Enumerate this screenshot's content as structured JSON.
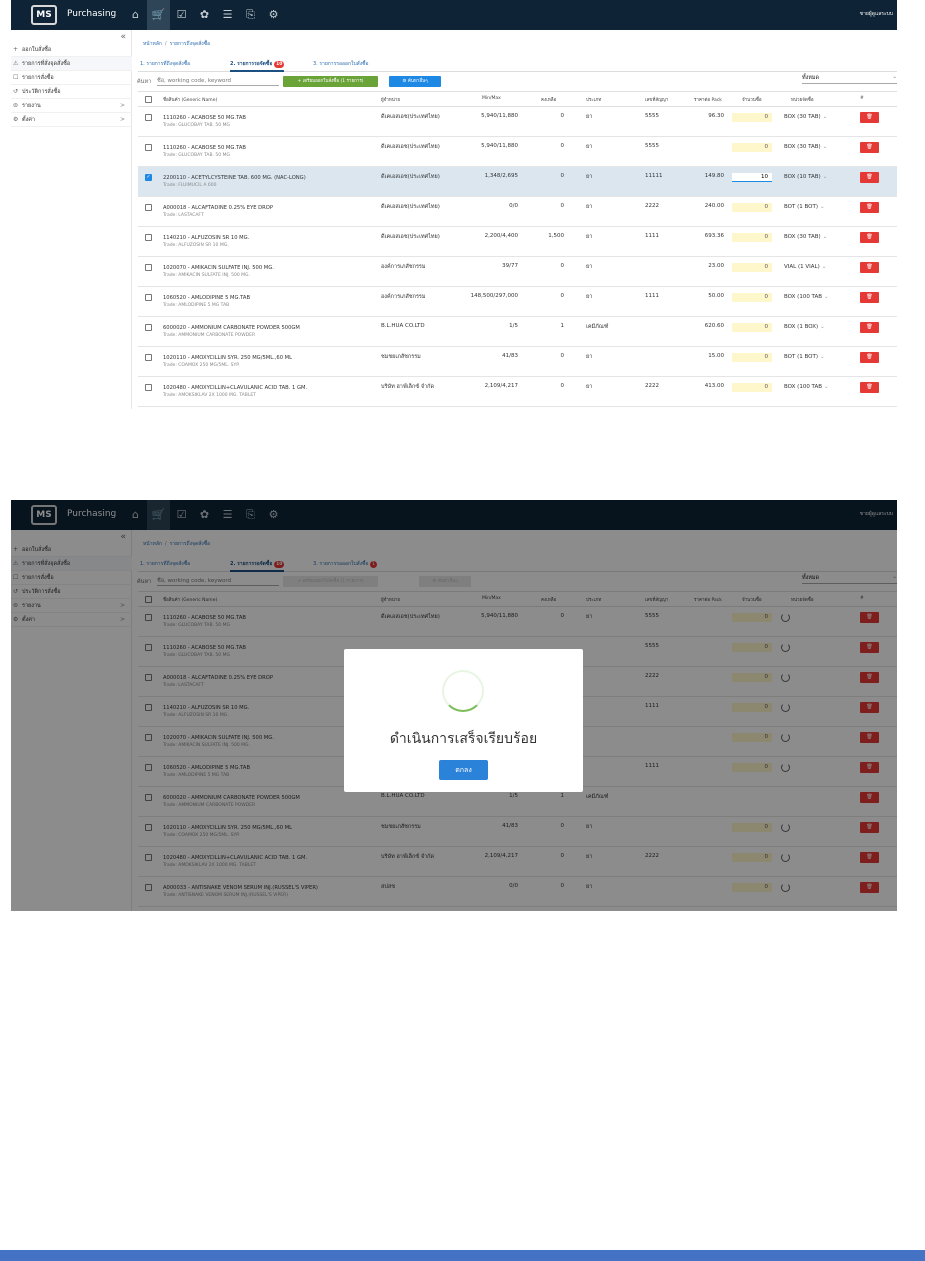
{
  "app": {
    "title": "Purchasing",
    "logo_text": "MS",
    "user": "ชายผู้ดูแลระบบ"
  },
  "nav_icons": [
    "home-icon",
    "cart-icon",
    "check-icon",
    "settings-icon",
    "list-icon",
    "document-icon",
    "gear-icon"
  ],
  "sidebar": {
    "collapse": "«",
    "items": [
      {
        "icon": "+",
        "label": "ออกใบสั่งซื้อ"
      },
      {
        "icon": "⚠",
        "label": "รายการที่สั่งจุดสั่งซื้อ"
      },
      {
        "icon": "☐",
        "label": "รายการสั่งซื้อ"
      },
      {
        "icon": "↺",
        "label": "ประวัติการสั่งซื้อ"
      },
      {
        "icon": "⊜",
        "label": "รายงาน",
        "chevron": ">"
      },
      {
        "icon": "⚙",
        "label": "ตั้งค่า",
        "chevron": ">"
      }
    ]
  },
  "breadcrumb": {
    "home": "หน้าหลัก",
    "sep": "/",
    "current": "รายการถึงจุดสั่งซื้อ"
  },
  "tabs": [
    {
      "label": "1. รายการที่ถึงจุดสั่งซื้อ"
    },
    {
      "label": "2. รายการรอจัดซื้อ",
      "badge": "10"
    },
    {
      "label": "3. รายการรอออกใบสั่งซื้อ",
      "badge": "1"
    }
  ],
  "toolbar": {
    "search_label": "ค้นหา",
    "search_placeholder": "ชื่อ, working code, keyword",
    "add_button": "+ เตรียมออกใบสั่งซื้อ (1 รายการ)",
    "save_button": "⚙ ค้นหาอื่นๆ",
    "filter_value": "ทั้งหมด"
  },
  "table": {
    "headers": [
      "ชื่อสินค้า (Generic Name)",
      "ผู้จำหน่าย",
      "Min/Max",
      "คงเหลือ",
      "ประเภท",
      "เลขที่สัญญา",
      "ราคาต่อ Pack",
      "จำนวนซื้อ",
      "หน่วยจัดซื้อ",
      "#"
    ]
  },
  "shot1": {
    "rows": [
      {
        "name": "1110260 - ACABOSE 50 MG.TAB",
        "trade": "Trade: GLUCOBAY TAB. 50 MG",
        "vendor": "ดีเคเอสเอช(ประเทศไทย)",
        "minmax": "5,940/11,880",
        "stock": "0",
        "type": "ยา",
        "contract": "5555",
        "price": "96.30",
        "qty": "0",
        "unit": "BOX (30 TAB)",
        "checked": false
      },
      {
        "name": "1110260 - ACABOSE 50 MG.TAB",
        "trade": "Trade: GLUCOBAY TAB. 50 MG",
        "vendor": "ดีเคเอสเอช(ประเทศไทย)",
        "minmax": "5,940/11,880",
        "stock": "0",
        "type": "ยา",
        "contract": "5555",
        "price": "",
        "qty": "0",
        "unit": "BOX (30 TAB)",
        "checked": false
      },
      {
        "name": "2200110 - ACETYLCYSTEINE TAB. 600 MG. (NAC-LONG)",
        "trade": "Trade: FLUIMUCIL A 600",
        "vendor": "ดีเคเอสเอช(ประเทศไทย)",
        "minmax": "1,348/2,695",
        "stock": "0",
        "type": "ยา",
        "contract": "11111",
        "price": "149.80",
        "qty": "10",
        "unit": "BOX (10 TAB)",
        "checked": true
      },
      {
        "name": "A000018 - ALCAFTADINE 0.25% EYE DROP",
        "trade": "Trade: LASTACAFT",
        "vendor": "ดีเคเอสเอช(ประเทศไทย)",
        "minmax": "0/0",
        "stock": "0",
        "type": "ยา",
        "contract": "2222",
        "price": "240.00",
        "qty": "0",
        "unit": "BOT (1 BOT)",
        "checked": false
      },
      {
        "name": "1140210 - ALFUZOSIN SR 10 MG.",
        "trade": "Trade: ALFUZOSIN SR 10 MG.",
        "vendor": "ดีเคเอสเอช(ประเทศไทย)",
        "minmax": "2,200/4,400",
        "stock": "1,500",
        "type": "ยา",
        "contract": "1111",
        "price": "693.36",
        "qty": "0",
        "unit": "BOX (30 TAB)",
        "checked": false
      },
      {
        "name": "1020070 - AMIKACIN SULFATE INJ. 500 MG.",
        "trade": "Trade: AMIKACIN SULFATE INJ. 500 MG.",
        "vendor": "องค์การเภสัชกรรม",
        "minmax": "39/77",
        "stock": "0",
        "type": "ยา",
        "contract": "",
        "price": "23.00",
        "qty": "0",
        "unit": "VIAL (1 VIAL)",
        "checked": false
      },
      {
        "name": "1060520 - AMLODIPINE 5 MG.TAB",
        "trade": "Trade: AMLODIPINE 5 MG TAB",
        "vendor": "องค์การเภสัชกรรม",
        "minmax": "148,500/297,000",
        "stock": "0",
        "type": "ยา",
        "contract": "1111",
        "price": "50.00",
        "qty": "0",
        "unit": "BOX (100 TAB",
        "checked": false
      },
      {
        "name": "6000020 - AMMONIUM CARBONATE POWDER 500GM",
        "trade": "Trade: AMMONIUM CARBONATE POWDER",
        "vendor": "B.L.HUA CO.LTD",
        "minmax": "1/5",
        "stock": "1",
        "type": "เคมีภัณฑ์",
        "contract": "",
        "price": "620.60",
        "qty": "0",
        "unit": "BOX (1 BOX)",
        "checked": false
      },
      {
        "name": "1020110 - AMOXYCILLIN SYR. 250 MG/5ML.,60 ML",
        "trade": "Trade: COAMOX 250 MG/5ML. SYP.",
        "vendor": "ชมชยเภสัชกรรม",
        "minmax": "41/83",
        "stock": "0",
        "type": "ยา",
        "contract": "",
        "price": "15.00",
        "qty": "0",
        "unit": "BOT (1 BOT)",
        "checked": false
      },
      {
        "name": "1020480 - AMOXYCILLIN+CLAVULANIC ACID TAB. 1 GM.",
        "trade": "Trade: AMOKSIKLAV 2X 1000 MG. TABLET",
        "vendor": "บริษัท ฮาฟ์เล็กซ์ จำกัด",
        "minmax": "2,109/4,217",
        "stock": "0",
        "type": "ยา",
        "contract": "2222",
        "price": "413.00",
        "qty": "0",
        "unit": "BOX (100 TAB",
        "checked": false
      }
    ]
  },
  "shot2": {
    "rows": [
      {
        "name": "1110260 - ACABOSE 50 MG.TAB",
        "trade": "Trade: GLUCOBAY TAB. 50 MG",
        "vendor": "ดีเคเอสเอช(ประเทศไทย)",
        "minmax": "5,940/11,880",
        "stock": "0",
        "type": "ยา",
        "contract": "5555",
        "qty": "0"
      },
      {
        "name": "1110260 - ACABOSE 50 MG.TAB",
        "trade": "Trade: GLUCOBAY TAB. 50 MG",
        "vendor": "",
        "minmax": "",
        "stock": "",
        "type": "",
        "contract": "5555",
        "qty": "0"
      },
      {
        "name": "A000018 - ALCAFTADINE 0.25% EYE DROP",
        "trade": "Trade: LASTACAFT",
        "vendor": "",
        "minmax": "",
        "stock": "",
        "type": "",
        "contract": "2222",
        "qty": "0"
      },
      {
        "name": "1140210 - ALFUZOSIN SR 10 MG.",
        "trade": "Trade: ALFUZOSIN SR 10 MG.",
        "vendor": "",
        "minmax": "",
        "stock": "",
        "type": "",
        "contract": "1111",
        "qty": "0"
      },
      {
        "name": "1020070 - AMIKACIN SULFATE INJ. 500 MG.",
        "trade": "Trade: AMIKACIN SULFATE INJ. 500 MG.",
        "vendor": "",
        "minmax": "",
        "stock": "",
        "type": "",
        "contract": "",
        "qty": "0"
      },
      {
        "name": "1060520 - AMLODIPINE 5 MG.TAB",
        "trade": "Trade: AMLODIPINE 5 MG TAB",
        "vendor": "",
        "minmax": "",
        "stock": "",
        "type": "",
        "contract": "1111",
        "qty": "0"
      },
      {
        "name": "6000020 - AMMONIUM CARBONATE POWDER 500GM",
        "trade": "Trade: AMMONIUM CARBONATE POWDER",
        "vendor": "B.L.HUA CO.LTD",
        "minmax": "1/5",
        "stock": "1",
        "type": "เคมีภัณฑ์",
        "contract": "",
        "qty": ""
      },
      {
        "name": "1020110 - AMOXYCILLIN SYR. 250 MG/5ML.,60 ML",
        "trade": "Trade: COAMOX 250 MG/5ML. SYP.",
        "vendor": "ชมชยเภสัชกรรม",
        "minmax": "41/83",
        "stock": "0",
        "type": "ยา",
        "contract": "",
        "qty": "0"
      },
      {
        "name": "1020480 - AMOXYCILLIN+CLAVULANIC ACID TAB. 1 GM.",
        "trade": "Trade: AMOKSIKLAV 2X 1000 MG. TABLET",
        "vendor": "บริษัท ฮาฟ์เล็กซ์ จำกัด",
        "minmax": "2,109/4,217",
        "stock": "0",
        "type": "ยา",
        "contract": "2222",
        "qty": "0"
      },
      {
        "name": "A000033 - ANTISNAKE VENOM SERUM INJ.(RUSSEL'S VIPER)",
        "trade": "Trade: ANTISNAKE VENOM SERUM INJ.(RUSSEL'S VIPER)",
        "vendor": "สปสช",
        "minmax": "0/0",
        "stock": "0",
        "type": "ยา",
        "contract": "",
        "qty": "0"
      }
    ],
    "modal": {
      "message": "ดำเนินการเสร็จเรียบร้อย",
      "ok_button": "ตกลง"
    }
  },
  "colors": {
    "topbar": "#0e2436",
    "accent": "#1e88e5",
    "danger": "#e53935",
    "success": "#6aa338",
    "qty_bg": "#fff7cc",
    "bottom_bar": "#4472c4"
  }
}
